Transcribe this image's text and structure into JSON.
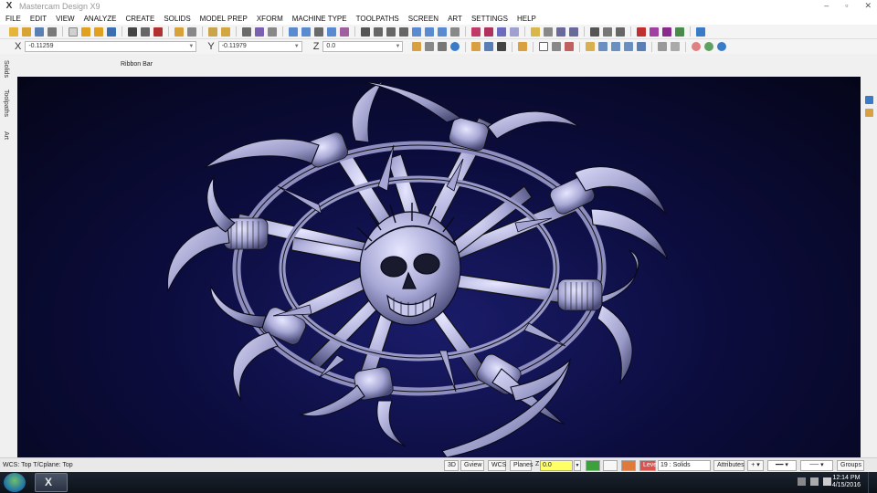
{
  "window": {
    "title": "Mastercam Design X9",
    "logo": "X",
    "controls": [
      "–",
      "▫",
      "✕"
    ]
  },
  "menu": [
    "FILE",
    "EDIT",
    "VIEW",
    "ANALYZE",
    "CREATE",
    "SOLIDS",
    "MODEL PREP",
    "XFORM",
    "MACHINE TYPE",
    "TOOLPATHS",
    "SCREEN",
    "ART",
    "SETTINGS",
    "HELP"
  ],
  "coords": {
    "x_label": "X",
    "x_value": "-0.11259",
    "y_label": "Y",
    "y_value": "-0.11979",
    "z_label": "Z",
    "z_value": "0.0"
  },
  "ribbon": {
    "label": "Ribbon Bar"
  },
  "side_tabs": [
    "Solids",
    "Toolpaths",
    "Art"
  ],
  "status": {
    "wcs_text": "WCS: Top  T/Cplane: Top",
    "btn_3d": "3D",
    "btn_gview": "Gview",
    "btn_wcs": "WCS",
    "btn_planes": "Planes",
    "z_label": "Z",
    "z_value": "0.0",
    "level_label": "Level",
    "level_value": "19 : Solids",
    "attributes": "Attributes",
    "groups": "Groups"
  },
  "taskbar": {
    "time": "12:14 PM",
    "date": "4/15/2016"
  },
  "colors": {
    "viewport_bg": "#0c0d3f",
    "model_fill": "#a8a8d6",
    "level_red": "#d9534f",
    "z_yellow": "#ffff66"
  }
}
